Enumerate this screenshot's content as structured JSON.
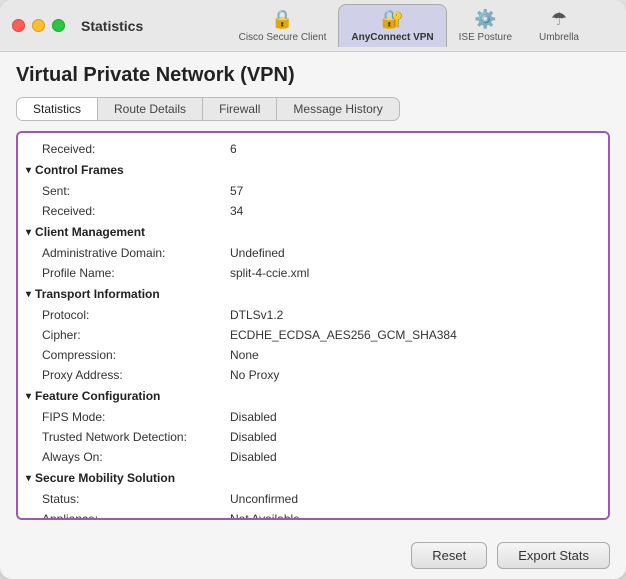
{
  "window": {
    "title": "Statistics"
  },
  "nav": {
    "tabs": [
      {
        "id": "cisco",
        "label": "Cisco Secure Client",
        "icon": "🔒",
        "active": false
      },
      {
        "id": "anyconnect",
        "label": "AnyConnect VPN",
        "icon": "🔐",
        "active": true
      },
      {
        "id": "ise",
        "label": "ISE Posture",
        "icon": "⚙️",
        "active": false
      },
      {
        "id": "umbrella",
        "label": "Umbrella",
        "icon": "☂",
        "active": false
      }
    ]
  },
  "vpn": {
    "title": "Virtual Private Network (VPN)",
    "subtabs": [
      {
        "id": "stats",
        "label": "Statistics",
        "active": true
      },
      {
        "id": "route",
        "label": "Route Details",
        "active": false
      },
      {
        "id": "firewall",
        "label": "Firewall",
        "active": false
      },
      {
        "id": "history",
        "label": "Message History",
        "active": false
      }
    ],
    "rows": [
      {
        "type": "label-value",
        "label": "Received:",
        "value": "6",
        "indent": true
      },
      {
        "type": "section",
        "label": "Control Frames"
      },
      {
        "type": "label-value",
        "label": "Sent:",
        "value": "57",
        "indent": true
      },
      {
        "type": "label-value",
        "label": "Received:",
        "value": "34",
        "indent": true
      },
      {
        "type": "section",
        "label": "Client Management"
      },
      {
        "type": "label-value",
        "label": "Administrative Domain:",
        "value": "Undefined",
        "indent": true
      },
      {
        "type": "label-value",
        "label": "Profile Name:",
        "value": "split-4-ccie.xml",
        "indent": true
      },
      {
        "type": "section",
        "label": "Transport Information"
      },
      {
        "type": "label-value",
        "label": "Protocol:",
        "value": "DTLSv1.2",
        "indent": true
      },
      {
        "type": "label-value",
        "label": "Cipher:",
        "value": "ECDHE_ECDSA_AES256_GCM_SHA384",
        "indent": true
      },
      {
        "type": "label-value",
        "label": "Compression:",
        "value": "None",
        "indent": true
      },
      {
        "type": "label-value",
        "label": "Proxy Address:",
        "value": "No Proxy",
        "indent": true
      },
      {
        "type": "section",
        "label": "Feature Configuration"
      },
      {
        "type": "label-value",
        "label": "FIPS Mode:",
        "value": "Disabled",
        "indent": true
      },
      {
        "type": "label-value",
        "label": "Trusted Network Detection:",
        "value": "Disabled",
        "indent": true
      },
      {
        "type": "label-value",
        "label": "Always On:",
        "value": "Disabled",
        "indent": true
      },
      {
        "type": "section",
        "label": "Secure Mobility Solution"
      },
      {
        "type": "label-value",
        "label": "Status:",
        "value": "Unconfirmed",
        "indent": true
      },
      {
        "type": "label-value",
        "label": "Appliance:",
        "value": "Not Available",
        "indent": true
      }
    ]
  },
  "buttons": {
    "reset": "Reset",
    "export": "Export Stats"
  }
}
